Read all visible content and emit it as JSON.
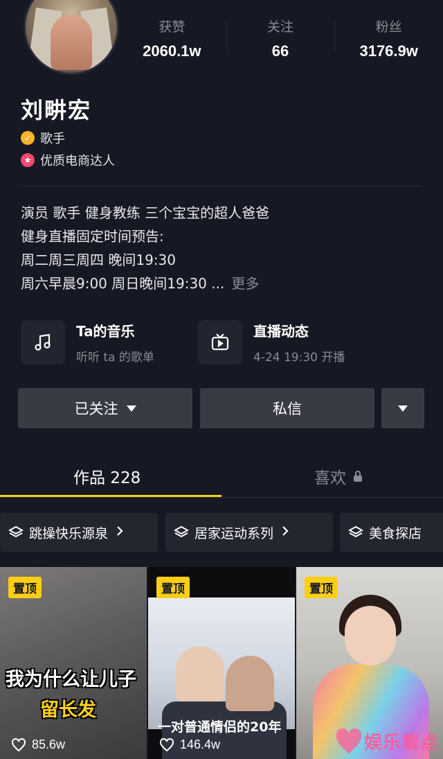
{
  "stats": [
    {
      "label": "获赞",
      "value": "2060.1w"
    },
    {
      "label": "关注",
      "value": "66"
    },
    {
      "label": "粉丝",
      "value": "3176.9w"
    }
  ],
  "profile": {
    "name": "刘畊宏",
    "badge1": "歌手",
    "badge2": "优质电商达人"
  },
  "bio": {
    "line1": "演员 歌手 健身教练 三个宝宝的超人爸爸",
    "line2": "健身直播固定时间预告:",
    "line3": "周二周三周四 晚间19:30",
    "line4": "周六早晨9:00 周日晚间19:30 ...",
    "more": "更多"
  },
  "features": [
    {
      "title": "Ta的音乐",
      "subtitle": "听听 ta 的歌单",
      "icon": "music-icon"
    },
    {
      "title": "直播动态",
      "subtitle": "4-24 19:30 开播",
      "icon": "tv-icon"
    }
  ],
  "actions": {
    "follow": "已关注",
    "message": "私信"
  },
  "tabs": {
    "works": "作品 228",
    "likes": "喜欢"
  },
  "collections": [
    {
      "label": "跳操快乐源泉"
    },
    {
      "label": "居家运动系列"
    },
    {
      "label": "美食探店"
    }
  ],
  "videos": [
    {
      "pin": "置顶",
      "caption_line1": "我为什么让儿子",
      "caption_line2": "留长发",
      "likes": "85.6w"
    },
    {
      "pin": "置顶",
      "caption": "一对普通情侣的20年",
      "likes": "146.4w"
    },
    {
      "pin": "置顶"
    }
  ],
  "watermark": "娱乐看点",
  "colors": {
    "background": "#161823",
    "accent": "#face15",
    "button": "#393b44",
    "muted": "#8a8b94"
  }
}
